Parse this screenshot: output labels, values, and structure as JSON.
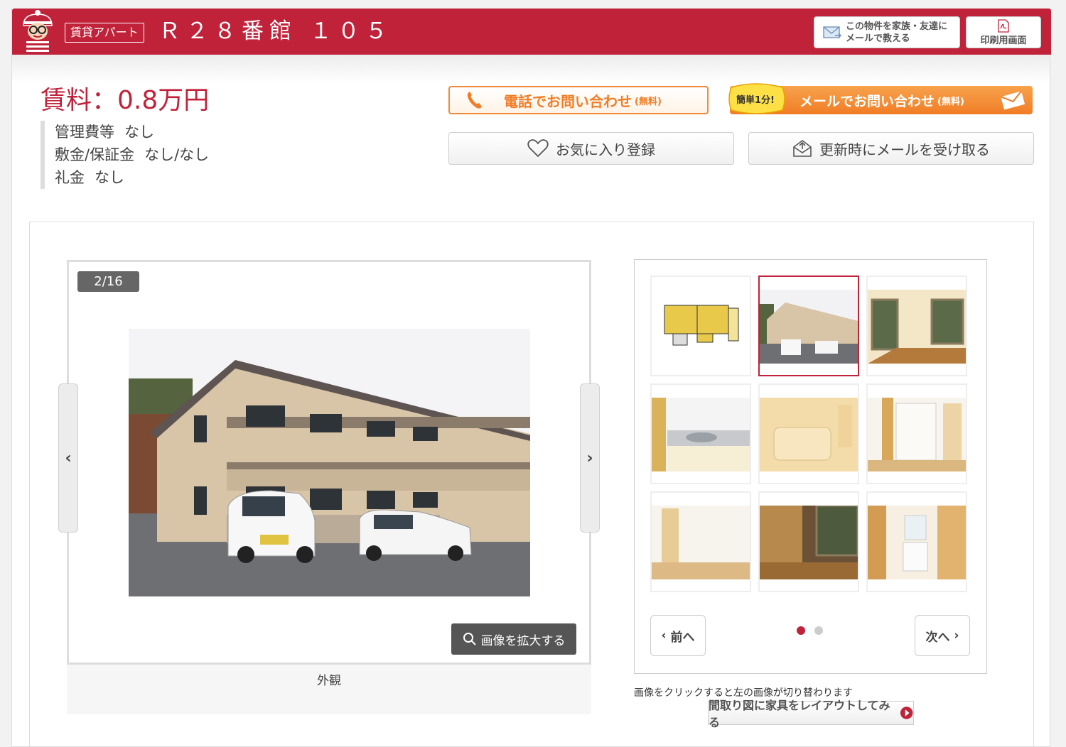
{
  "header": {
    "property_type": "賃貸アパート",
    "title": "Ｒ２８番館 １０５",
    "share_label_line1": "この物件を家族・友達に",
    "share_label_line2": "メールで教える",
    "print_label": "印刷用画面"
  },
  "rent": {
    "price": "賃料：0.8万円",
    "fees": [
      {
        "label": "管理費等",
        "value": "なし"
      },
      {
        "label": "敷金/保証金",
        "value": "なし/なし"
      },
      {
        "label": "礼金",
        "value": "なし"
      }
    ]
  },
  "contact": {
    "tel_label": "電話でお問い合わせ",
    "tel_sub": "(無料)",
    "mail_badge": "簡単1分!",
    "mail_label": "メールでお問い合わせ",
    "mail_sub": "(無料)",
    "favorite_label": "お気に入り登録",
    "update_label": "更新時にメールを受け取る"
  },
  "gallery": {
    "counter": "2/16",
    "zoom_label": "画像を拡大する",
    "caption": "外観",
    "prev_label": "前へ",
    "next_label": "次へ",
    "hint": "画像をクリックすると左の画像が切り替わります",
    "layout_label": "間取り図に家具をレイアウトしてみる",
    "active_thumb": 2,
    "current_page": 1,
    "page_count": 2
  },
  "colors": {
    "brand": "#c0223a",
    "accent_orange": "#f07d26"
  },
  "icons": [
    "mascot-icon",
    "envelope-icon",
    "pdf-icon",
    "phone-icon",
    "heart-icon",
    "mail-update-icon",
    "search-icon",
    "chevron-left-icon",
    "chevron-right-icon",
    "play-icon"
  ]
}
